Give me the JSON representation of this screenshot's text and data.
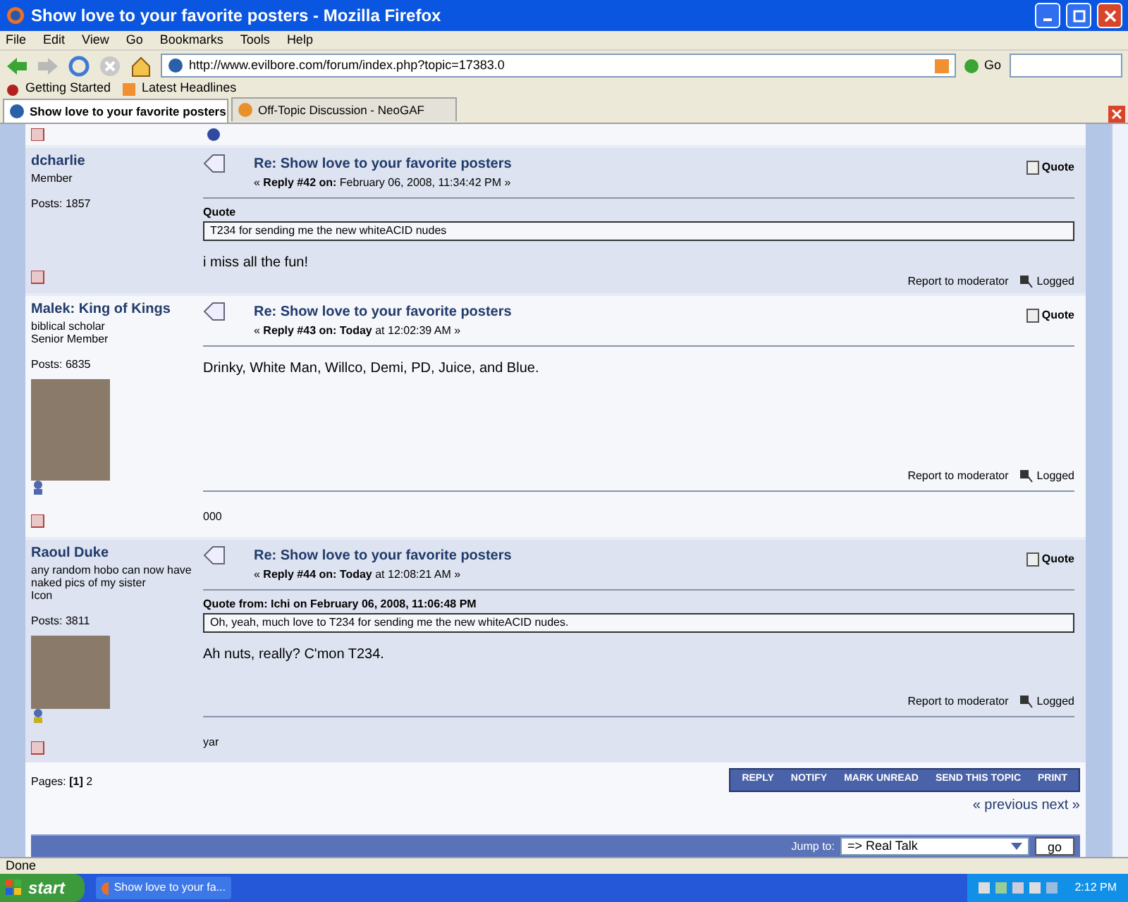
{
  "window": {
    "title": "Show love to your favorite posters - Mozilla Firefox"
  },
  "menu": [
    "File",
    "Edit",
    "View",
    "Go",
    "Bookmarks",
    "Tools",
    "Help"
  ],
  "address": {
    "value": "http://www.evilbore.com/forum/index.php?topic=17383.0",
    "go": "Go"
  },
  "bookmarks": [
    "Getting Started",
    "Latest Headlines"
  ],
  "tabs": [
    {
      "label": "Show love to your favorite posters",
      "selected": true
    },
    {
      "label": "Off-Topic Discussion - NeoGAF",
      "selected": false
    }
  ],
  "posts": [
    {
      "author": "dcharlie",
      "titles": [
        "Member"
      ],
      "posts": "Posts: 1857",
      "avatar": false,
      "subject": "Re: Show love to your favorite posters",
      "reply": "« **Reply #42 on:** February 06, 2008, 11:34:42 PM »",
      "quote_action": "Quote",
      "quote": {
        "header": "Quote",
        "text": "T234 for sending me the new whiteACID nudes"
      },
      "body": "i miss all the fun!",
      "report": "Report to moderator",
      "logged": "Logged"
    },
    {
      "author": "Malek: King of Kings",
      "titles": [
        "biblical scholar",
        "Senior Member"
      ],
      "posts": "Posts: 6835",
      "avatar": true,
      "subject": "Re: Show love to your favorite posters",
      "reply": "« **Reply #43 on: Today** at 12:02:39 AM »",
      "quote_action": "Quote",
      "body": "Drinky, White Man, Willco, Demi, PD, Juice, and Blue.",
      "report": "Report to moderator",
      "logged": "Logged",
      "signature": "000"
    },
    {
      "author": "Raoul Duke",
      "titles": [
        "any random hobo can now have naked pics of my sister",
        "Icon"
      ],
      "posts": "Posts: 3811",
      "avatar": true,
      "subject": "Re: Show love to your favorite posters",
      "reply": "« **Reply #44 on: Today** at 12:08:21 AM »",
      "quote_action": "Quote",
      "quote": {
        "header": "Quote from: Ichi on February 06, 2008, 11:06:48 PM",
        "text": "Oh, yeah, much love to T234 for sending me the new whiteACID nudes."
      },
      "body": "Ah nuts, really?  C'mon T234.",
      "report": "Report to moderator",
      "logged": "Logged",
      "signature": "yar"
    }
  ],
  "pages": "Pages: **[1]** 2",
  "actions": [
    "REPLY",
    "NOTIFY",
    "MARK UNREAD",
    "SEND THIS TOPIC",
    "PRINT"
  ],
  "prev_next": "« previous next »",
  "jump": {
    "label": "Jump to:",
    "value": "=> Real Talk",
    "go": "go"
  },
  "status": "Done",
  "taskbar": {
    "start": "start",
    "task": "Show love to your fa...",
    "time": "2:12 PM"
  }
}
